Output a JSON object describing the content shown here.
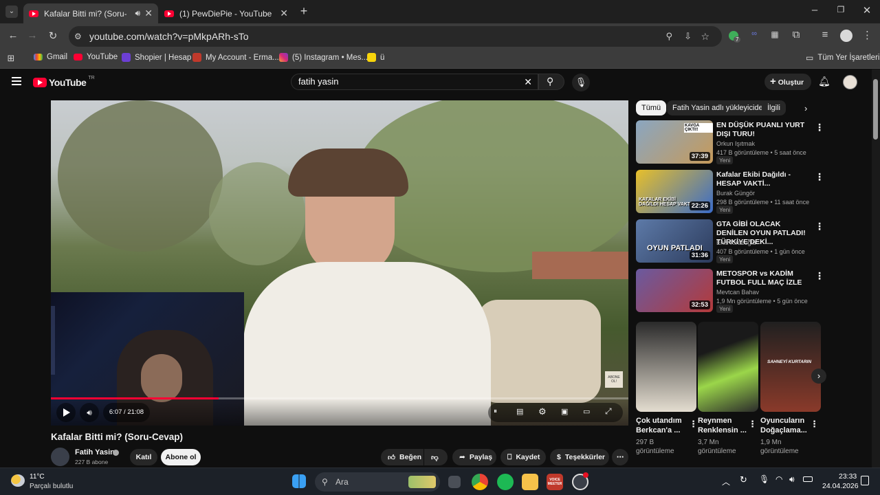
{
  "browser": {
    "tabs": [
      {
        "title": "Kafalar Bitti mi? (Soru-Cevap)",
        "active": true
      },
      {
        "title": "(1) PewDiePie - YouTube",
        "active": false
      }
    ],
    "url": "youtube.com/watch?v=pMkpARh-sTo",
    "extension_badge": "7",
    "bookmarks": [
      "Gmail",
      "YouTube",
      "Shopier | Hesap",
      "My Account - Erma...",
      "(5) Instagram • Mes...",
      "ü"
    ],
    "all_bookmarks": "Tüm Yer İşaretleri"
  },
  "youtube": {
    "logo_text": "YouTube",
    "logo_sup": "TR",
    "search_value": "fatih yasin",
    "create_label": "Oluştur",
    "player": {
      "time": "6:07 / 21:08",
      "progress": 0.29,
      "watermark": "ABONE OL!"
    },
    "video_title": "Kafalar Bitti mi? (Soru-Cevap)",
    "channel": {
      "name": "Fatih Yasin",
      "subs": "227 B abone"
    },
    "join_label": "Katıl",
    "subscribe_label": "Abone ol",
    "actions": {
      "like": "Beğen",
      "share": "Paylaş",
      "save": "Kaydet",
      "thanks": "Teşekkürler"
    },
    "chips": [
      "Tümü",
      "Fatih Yasin adlı yükleyiciden",
      "İlgili"
    ],
    "recommendations": [
      {
        "title": "EN DÜŞÜK PUANLI YURT DIŞI TURU!",
        "channel": "Orkun Işıtmak",
        "meta": "417 B görüntüleme • 5 saat önce",
        "duration": "37:39",
        "badge": "Yeni",
        "thumb_text": "KAVGA ÇIKTI!!"
      },
      {
        "title": "Kafalar Ekibi Dağıldı - HESAP VAKTİ...",
        "channel": "Burak Güngör",
        "meta": "298 B görüntüleme • 11 saat önce",
        "duration": "22:26",
        "badge": "Yeni",
        "thumb_text": "KAFALAR EKİBİ DAĞILDI HESAP VAKTİ"
      },
      {
        "title": "GTA GİBİ OLACAK DENİLEN OYUN PATLADI! TÜRKİYE'DEKİ...",
        "channel": "Enis Kirazoğlu",
        "meta": "407 B görüntüleme • 1 gün önce",
        "duration": "31:36",
        "badge": "Yeni",
        "thumb_text": "OYUN PATLADI"
      },
      {
        "title": "METOSPOR vs KADİM FUTBOL FULL MAÇ İZLE",
        "channel": "Mevtcan Bahav",
        "meta": "1,9 Mn görüntüleme • 5 gün önce",
        "duration": "32:53",
        "badge": "Yeni",
        "thumb_text": ""
      }
    ],
    "shorts": [
      {
        "title1": "Çok utandım",
        "title2": "Berkcan'a ...",
        "views1": "297 B",
        "views2": "görüntüleme"
      },
      {
        "title1": "Reynmen",
        "title2": "Renklensin ...",
        "views1": "3,7 Mn",
        "views2": "görüntüleme"
      },
      {
        "title1": "Oyuncuların",
        "title2": "Doğaçlama...",
        "views1": "1,9 Mn",
        "views2": "görüntüleme",
        "overlay": "SAHNEYİ KURTARIN"
      }
    ]
  },
  "taskbar": {
    "weather_temp": "11°C",
    "weather_desc": "Parçalı bulutlu",
    "search_placeholder": "Ara",
    "time": "23:33",
    "date": "24.04.2026",
    "voicemeeter": "VOICE MEETER"
  }
}
